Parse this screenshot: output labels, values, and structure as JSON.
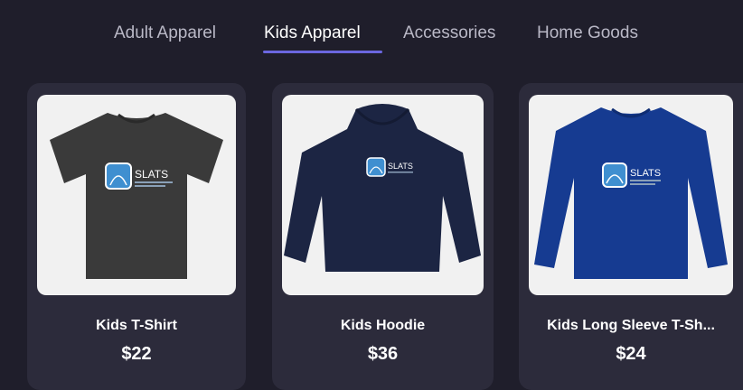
{
  "tabs": [
    {
      "label": "Adult Apparel"
    },
    {
      "label": "Kids Apparel",
      "active": true
    },
    {
      "label": "Accessories"
    },
    {
      "label": "Home Goods"
    }
  ],
  "products": [
    {
      "name": "Kids T-Shirt",
      "price": "$22",
      "garment_color": "#3a3a3a",
      "logo_text": "SLATS"
    },
    {
      "name": "Kids Hoodie",
      "price": "$36",
      "garment_color": "#1c2543",
      "logo_text": "SLATS"
    },
    {
      "name": "Kids Long Sleeve T-Sh...",
      "price": "$24",
      "garment_color": "#163b91",
      "logo_text": "SLATS"
    }
  ],
  "colors": {
    "background": "#1f1e2b",
    "card": "#2c2b3b",
    "accent": "#6b67e0",
    "tab_inactive": "#b9b8c6"
  }
}
